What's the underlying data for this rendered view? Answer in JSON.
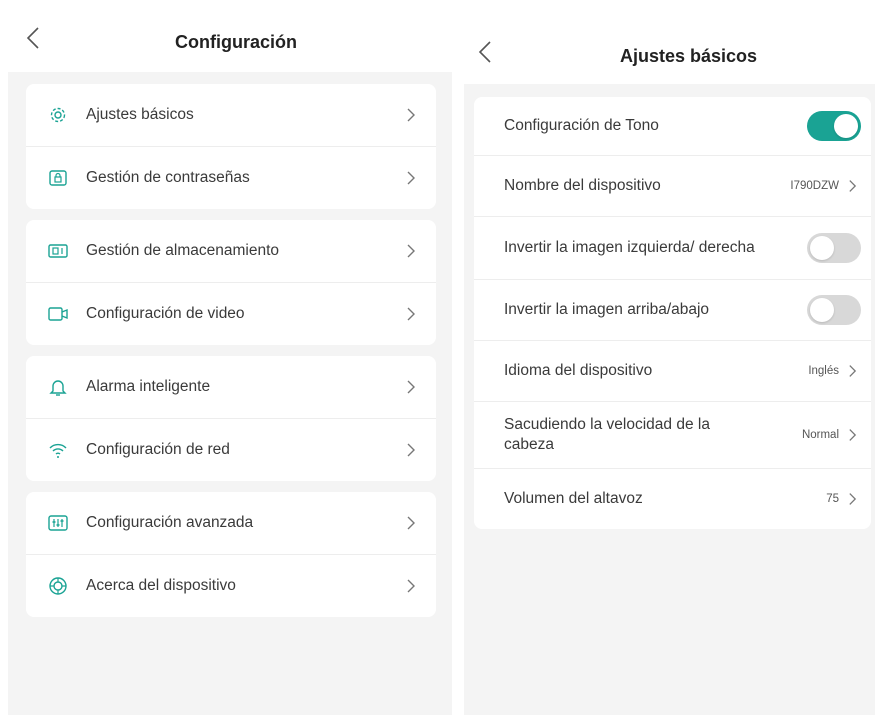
{
  "left": {
    "title": "Configuración",
    "groups": [
      [
        {
          "label": "Ajustes básicos",
          "icon": "gear-icon"
        },
        {
          "label": "Gestión de contraseñas",
          "icon": "lock-icon"
        }
      ],
      [
        {
          "label": "Gestión de almacenamiento",
          "icon": "sd-card-icon"
        },
        {
          "label": "Configuración de video",
          "icon": "video-camera-icon"
        }
      ],
      [
        {
          "label": "Alarma inteligente",
          "icon": "bell-icon"
        },
        {
          "label": "Configuración de red",
          "icon": "wifi-icon"
        }
      ],
      [
        {
          "label": "Configuración avanzada",
          "icon": "sliders-icon"
        },
        {
          "label": "Acerca del dispositivo",
          "icon": "info-ring-icon"
        }
      ]
    ]
  },
  "right": {
    "title": "Ajustes básicos",
    "rows": [
      {
        "label": "Configuración de Tono",
        "type": "toggle",
        "state": "on"
      },
      {
        "label": "Nombre del dispositivo",
        "type": "value",
        "value": "I790DZW"
      },
      {
        "label": "Invertir la imagen izquierda/ derecha",
        "type": "toggle",
        "state": "off"
      },
      {
        "label": "Invertir la imagen arriba/abajo",
        "type": "toggle",
        "state": "off"
      },
      {
        "label": "Idioma del dispositivo",
        "type": "value",
        "value": "Inglés"
      },
      {
        "label": "Sacudiendo la velocidad de la cabeza",
        "type": "value",
        "value": "Normal"
      },
      {
        "label": "Volumen del altavoz",
        "type": "value",
        "value": "75"
      }
    ]
  },
  "colors": {
    "accent": "#1aa394",
    "toggle_off": "#d8d8d8",
    "background": "#f4f4f4"
  }
}
